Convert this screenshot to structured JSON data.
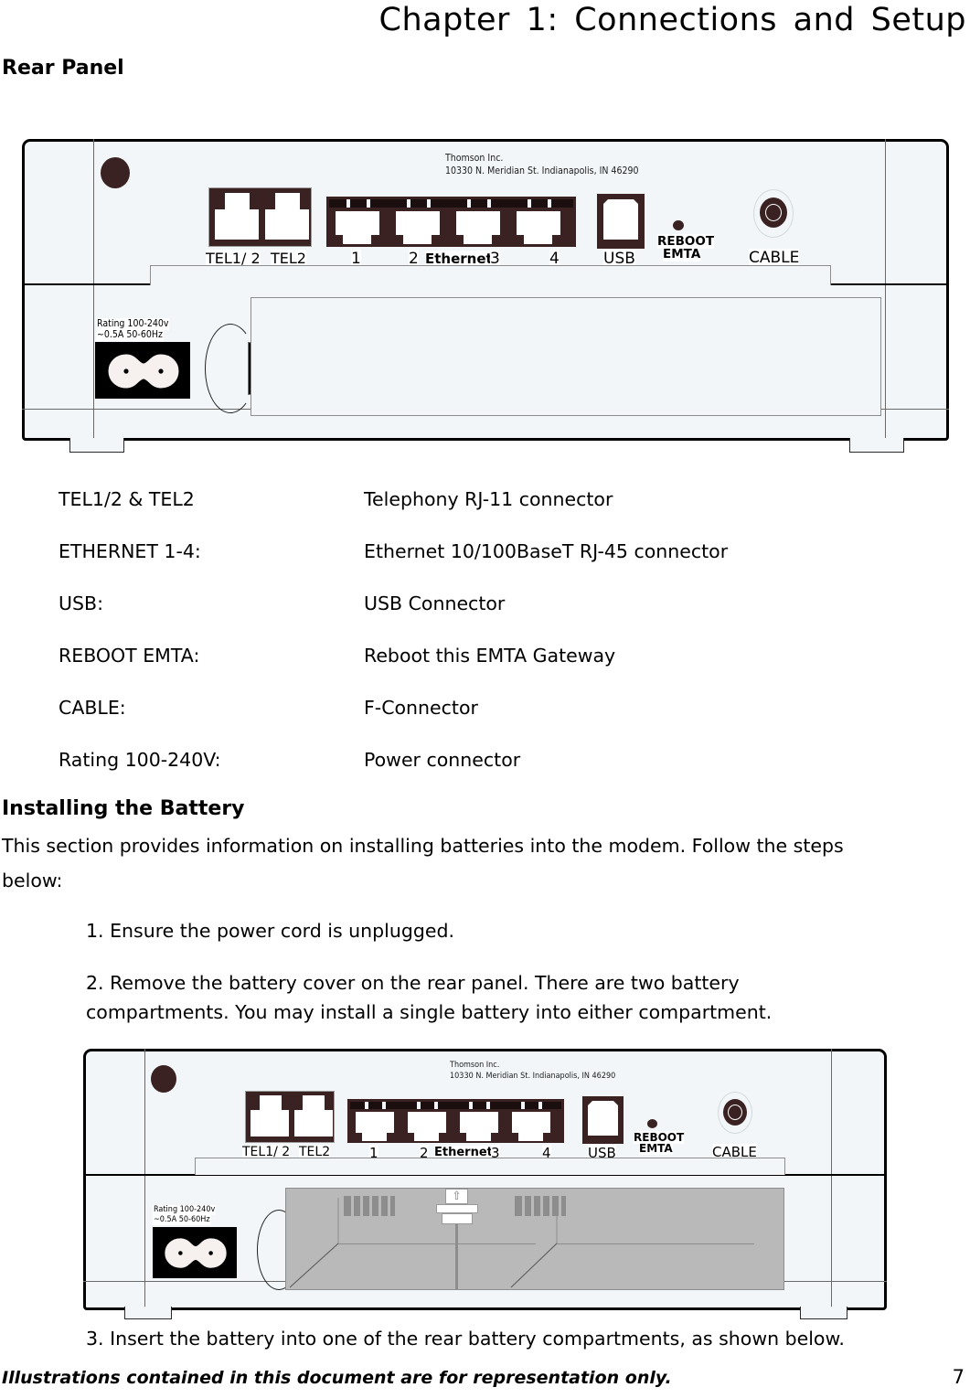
{
  "header": {
    "chapter_title": "Chapter 1: Connections and Setup"
  },
  "sections": {
    "rear_panel_heading": "Rear Panel",
    "battery_heading": "Installing the Battery",
    "battery_intro_line1": "This section provides information on installing batteries into the modem. Follow the steps",
    "battery_intro_line2": "below:"
  },
  "connector_list": [
    {
      "term": "TEL1/2 & TEL2",
      "description": "Telephony RJ-11 connector"
    },
    {
      "term": "ETHERNET 1-4:",
      "description": "Ethernet 10/100BaseT RJ-45 connector"
    },
    {
      "term": "USB:",
      "description": "USB Connector"
    },
    {
      "term": "REBOOT EMTA:",
      "description": "Reboot this EMTA Gateway"
    },
    {
      "term": "CABLE:",
      "description": "F-Connector"
    },
    {
      "term": "Rating 100-240V:",
      "description": "Power connector"
    }
  ],
  "steps": {
    "step1": "1. Ensure the power cord is unplugged.",
    "step2_line1": "2. Remove the battery cover on the rear panel. There are two battery",
    "step2_line2": "compartments. You may install a single battery into either compartment.",
    "step3": "3. Insert the battery into one of the rear battery compartments, as shown below."
  },
  "device": {
    "manufacturer_line1": "Thomson Inc.",
    "manufacturer_line2": "10330 N. Meridian St. Indianapolis, IN 46290",
    "labels": {
      "tel1": "TEL1/ 2",
      "tel2": "TEL2",
      "eth1": "1",
      "eth2": "2",
      "ethernet": "Ethernet",
      "eth3": "3",
      "eth4": "4",
      "usb": "USB",
      "reboot_line1": "REBOOT",
      "reboot_line2": "EMTA",
      "cable": "CABLE"
    },
    "rating_line1": "Rating 100-240v",
    "rating_line2": "~0.5A 50-60Hz",
    "connector_arrow_glyph": "⇧"
  },
  "footer": {
    "note": "Illustrations contained in this document are for representation only.",
    "page_number": "7"
  },
  "colors": {
    "panel": "#f2f6f8",
    "port_dark": "#3a2222",
    "bay_gray": "#b9b9b9",
    "vent_gray": "#8d8d8d",
    "outline": "#000000"
  }
}
